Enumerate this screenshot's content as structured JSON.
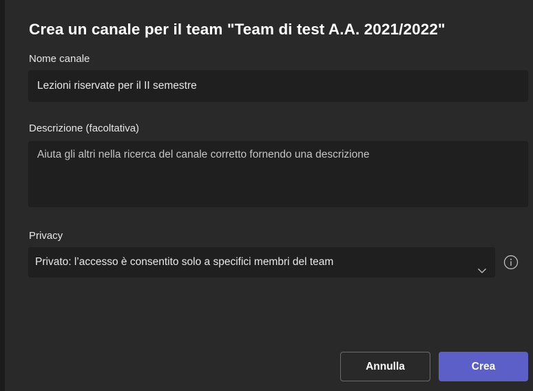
{
  "dialog": {
    "title": "Crea un canale per il team \"Team di test A.A. 2021/2022\""
  },
  "channel_name": {
    "label": "Nome canale",
    "value": "Lezioni riservate per il II semestre"
  },
  "description": {
    "label": "Descrizione (facoltativa)",
    "placeholder": "Aiuta gli altri nella ricerca del canale corretto fornendo una descrizione"
  },
  "privacy": {
    "label": "Privacy",
    "selected": "Privato: l’accesso è consentito solo a specifici membri del team",
    "dropdown_icon": "chevron-down-icon",
    "info_icon": "info-icon"
  },
  "actions": {
    "cancel_label": "Annulla",
    "create_label": "Crea"
  },
  "colors": {
    "background": "#292929",
    "field_background": "#1f1f1f",
    "accent": "#5b5fc7",
    "text": "#ffffff"
  }
}
